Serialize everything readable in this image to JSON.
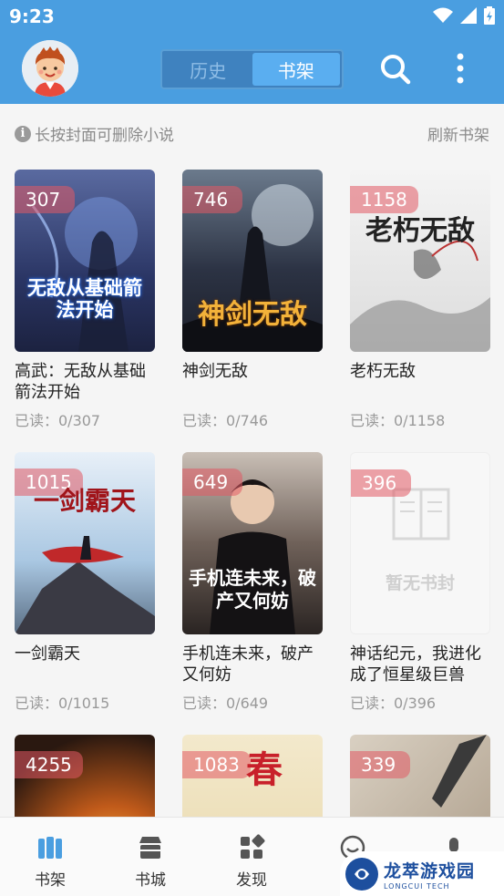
{
  "status_bar": {
    "time": "9:23"
  },
  "app_bar": {
    "tabs": [
      {
        "label": "历史",
        "active": false
      },
      {
        "label": "书架",
        "active": true
      }
    ],
    "icons": [
      "avatar",
      "search-icon",
      "more-vert-icon"
    ]
  },
  "hint_bar": {
    "hint": "长按封面可删除小说",
    "refresh": "刷新书架"
  },
  "books": [
    {
      "title": "高武：无敌从基础箭法开始",
      "progress": "已读：0/307",
      "badge": "307",
      "cover_text": "无敌从基础箭法开始",
      "cover_color": "#3a4a7a"
    },
    {
      "title": "神剑无敌",
      "progress": "已读：0/746",
      "badge": "746",
      "cover_text": "神剑无敌",
      "cover_color": "#2c3344"
    },
    {
      "title": "老朽无敌",
      "progress": "已读：0/1158",
      "badge": "1158",
      "cover_text": "老朽无敌",
      "cover_color": "#e9e9e9"
    },
    {
      "title": "一剑霸天",
      "progress": "已读：0/1015",
      "badge": "1015",
      "cover_text": "一剑霸天",
      "cover_color": "#b8d2ea"
    },
    {
      "title": "手机连未来，破产又何妨",
      "progress": "已读：0/649",
      "badge": "649",
      "cover_text": "手机连未来，破产又何妨",
      "cover_color": "#3a3230"
    },
    {
      "title": "神话纪元，我进化成了恒星级巨兽",
      "progress": "已读：0/396",
      "badge": "396",
      "cover_text": "暂无书封",
      "cover_color": "#f7f7f7"
    },
    {
      "title": "",
      "progress": "",
      "badge": "4255",
      "cover_text": "",
      "cover_color": "#c05a1a"
    },
    {
      "title": "",
      "progress": "",
      "badge": "1083",
      "cover_text": "春",
      "cover_color": "#efe3c0"
    },
    {
      "title": "",
      "progress": "",
      "badge": "339",
      "cover_text": "",
      "cover_color": "#b8aa98"
    }
  ],
  "bottom_nav": [
    {
      "label": "书架",
      "icon": "bookshelf-icon",
      "active": true
    },
    {
      "label": "书城",
      "icon": "store-icon",
      "active": false
    },
    {
      "label": "发现",
      "icon": "discover-icon",
      "active": false
    },
    {
      "label": "",
      "icon": "profile-icon",
      "active": false
    },
    {
      "label": "",
      "icon": "mine-icon",
      "active": false
    }
  ],
  "watermark": {
    "cn": "龙萃游戏园",
    "en": "LONGCUI TECH"
  },
  "colors": {
    "primary": "#4a9ee0",
    "badge": "#e15a64",
    "background": "#f5f5f5"
  }
}
